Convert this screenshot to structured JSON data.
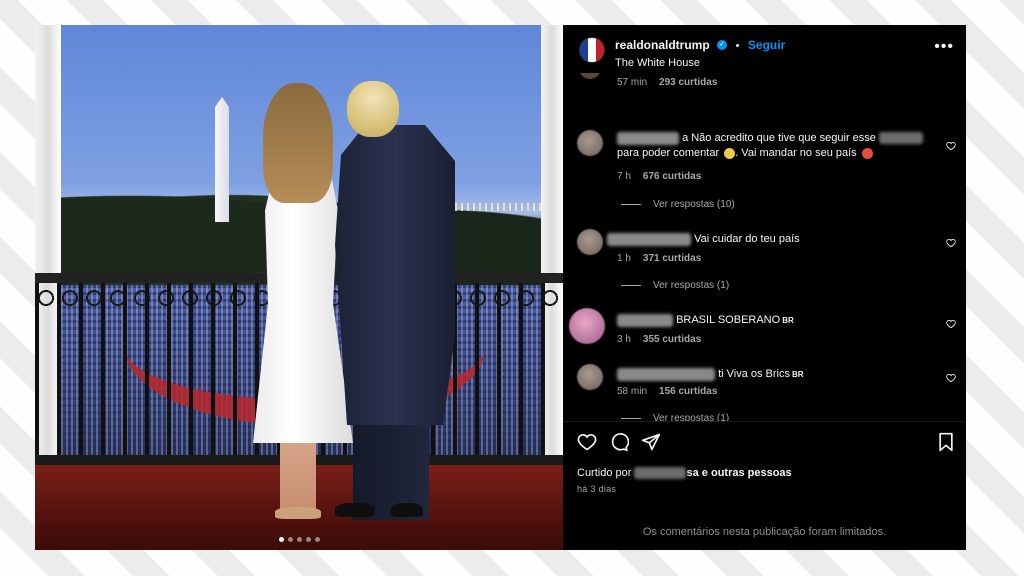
{
  "header": {
    "username": "realdonaldtrump",
    "separator": "•",
    "follow_label": "Seguir",
    "location": "The White House",
    "more_label": "•••"
  },
  "top_partial": {
    "time": "57 min",
    "likes": "293 curtidas"
  },
  "comments": [
    {
      "text_a": "a Não acredito que tive que seguir esse",
      "text_b": "para poder comentar",
      "text_c": ". Vai mandar no seu país",
      "time": "7 h",
      "likes": "676 curtidas",
      "replies": "Ver respostas (10)"
    },
    {
      "text": "Vai cuidar do teu país",
      "time": "1 h",
      "likes": "371 curtidas",
      "replies": "Ver respostas (1)"
    },
    {
      "text": "BRASIL SOBERANO",
      "tag": "BR",
      "time": "3 h",
      "likes": "355 curtidas"
    },
    {
      "text": "ti Viva os Brics",
      "tag": "BR",
      "time": "58 min",
      "likes": "156 curtidas",
      "replies": "Ver respostas (1)"
    }
  ],
  "liked_by": {
    "prefix": "Curtido por",
    "partial_name": "sa",
    "suffix": "e outras pessoas"
  },
  "time_ago": "há 3 dias",
  "limited_note": "Os comentários nesta publicação foram limitados.",
  "carousel": {
    "count": 5,
    "active_index": 0
  },
  "colors": {
    "accent": "#0095f6",
    "panel_bg": "#000000",
    "text": "#f5f5f5",
    "muted": "#a8a8a8"
  },
  "icons": [
    "verified-badge-icon",
    "more-options-icon",
    "heart-icon",
    "comment-icon",
    "share-icon",
    "bookmark-icon"
  ]
}
